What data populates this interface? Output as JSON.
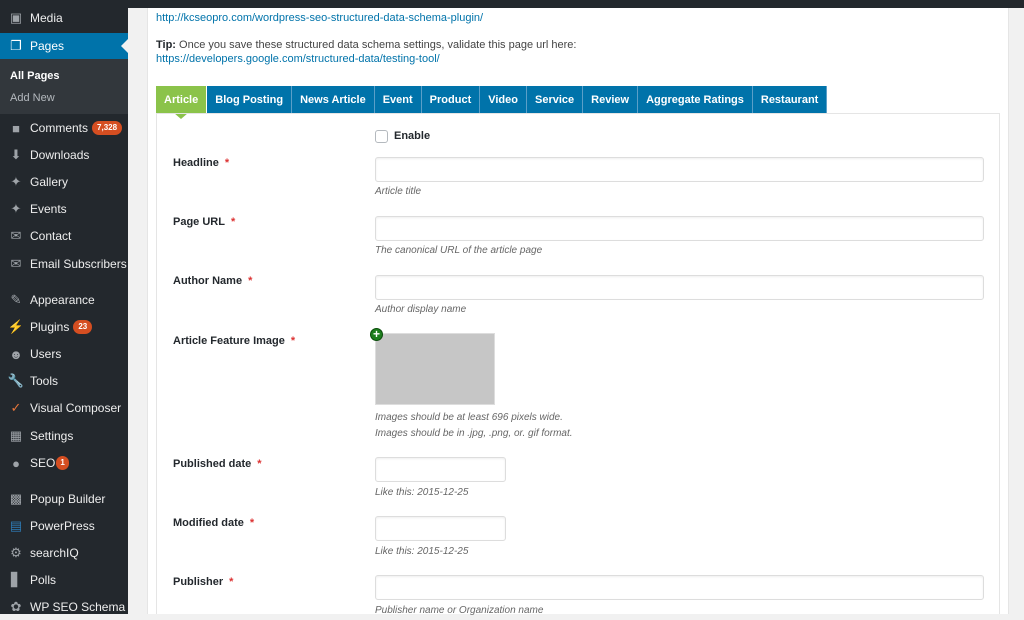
{
  "sidebar": {
    "items": [
      {
        "label": "Media",
        "icon": "media-icon"
      },
      {
        "label": "Pages",
        "icon": "pages-icon",
        "active": true
      },
      {
        "label": "Comments",
        "icon": "comments-icon",
        "badge": "7,328"
      },
      {
        "label": "Downloads",
        "icon": "downloads-icon"
      },
      {
        "label": "Gallery",
        "icon": "pin-icon"
      },
      {
        "label": "Events",
        "icon": "pin-icon"
      },
      {
        "label": "Contact",
        "icon": "mail-icon"
      },
      {
        "label": "Email Subscribers",
        "icon": "mail-icon"
      },
      {
        "label": "Appearance",
        "icon": "brush-icon"
      },
      {
        "label": "Plugins",
        "icon": "plugin-icon",
        "badge": "23"
      },
      {
        "label": "Users",
        "icon": "user-icon"
      },
      {
        "label": "Tools",
        "icon": "wrench-icon"
      },
      {
        "label": "Visual Composer",
        "icon": "visual-composer-icon"
      },
      {
        "label": "Settings",
        "icon": "settings-icon"
      },
      {
        "label": "SEO",
        "icon": "seo-icon",
        "badge": "1"
      },
      {
        "label": "Popup Builder",
        "icon": "popup-icon"
      },
      {
        "label": "PowerPress",
        "icon": "powerpress-icon"
      },
      {
        "label": "searchIQ",
        "icon": "gear-icon"
      },
      {
        "label": "Polls",
        "icon": "bar-chart-icon"
      },
      {
        "label": "WP SEO Schema",
        "icon": "schema-icon"
      }
    ],
    "submenu": [
      {
        "label": "All Pages",
        "current": true
      },
      {
        "label": "Add New"
      }
    ]
  },
  "header": {
    "plugin_link": "http://kcseopro.com/wordpress-seo-structured-data-schema-plugin/",
    "tip_label": "Tip:",
    "tip_text": " Once you save these structured data schema settings, validate this page url here:",
    "testing_link": "https://developers.google.com/structured-data/testing-tool/"
  },
  "tabs": [
    {
      "label": "Article",
      "active": true
    },
    {
      "label": "Blog Posting"
    },
    {
      "label": "News Article"
    },
    {
      "label": "Event"
    },
    {
      "label": "Product"
    },
    {
      "label": "Video"
    },
    {
      "label": "Service"
    },
    {
      "label": "Review"
    },
    {
      "label": "Aggregate Ratings"
    },
    {
      "label": "Restaurant"
    }
  ],
  "form": {
    "enable_label": "Enable",
    "enable_checked": false,
    "required_mark": "*",
    "fields": [
      {
        "label": "Headline",
        "value": "",
        "description": "Article title"
      },
      {
        "label": "Page URL",
        "value": "",
        "description": "The canonical URL of the article page"
      },
      {
        "label": "Author Name",
        "value": "",
        "description": "Author display name"
      },
      {
        "label": "Article Feature Image",
        "description": "Images should be at least 696 pixels wide.",
        "description2": "Images should be in .jpg, .png, or. gif format."
      },
      {
        "label": "Published date",
        "value": "",
        "description": "Like this: 2015-12-25"
      },
      {
        "label": "Modified date",
        "value": "",
        "description": "Like this: 2015-12-25"
      },
      {
        "label": "Publisher",
        "value": "",
        "description": "Publisher name or Organization name"
      }
    ]
  }
}
